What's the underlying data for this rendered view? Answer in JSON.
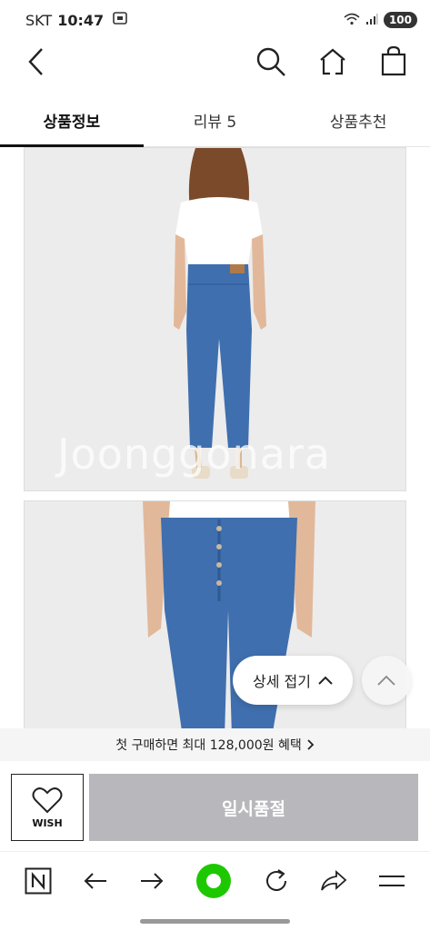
{
  "status_bar": {
    "carrier": "SKT",
    "time": "10:47",
    "battery": "100"
  },
  "topnav": {
    "icons": [
      "back-chevron-icon",
      "search-icon",
      "home-icon",
      "shopping-bag-icon"
    ]
  },
  "tabs": [
    {
      "label": "상품정보",
      "active": true
    },
    {
      "label": "리뷰 5",
      "active": false
    },
    {
      "label": "상품추천",
      "active": false
    }
  ],
  "content": {
    "watermark": "Joonggonara",
    "fold_label": "상세 접기"
  },
  "promo": {
    "text": "첫 구매하면 최대 128,000원 혜택"
  },
  "actions": {
    "wish_label": "WISH",
    "soldout_label": "일시품절"
  },
  "colors": {
    "soldout_bg": "#b8b7bc",
    "accent_green": "#1ec800",
    "denim": "#3f6fae"
  }
}
